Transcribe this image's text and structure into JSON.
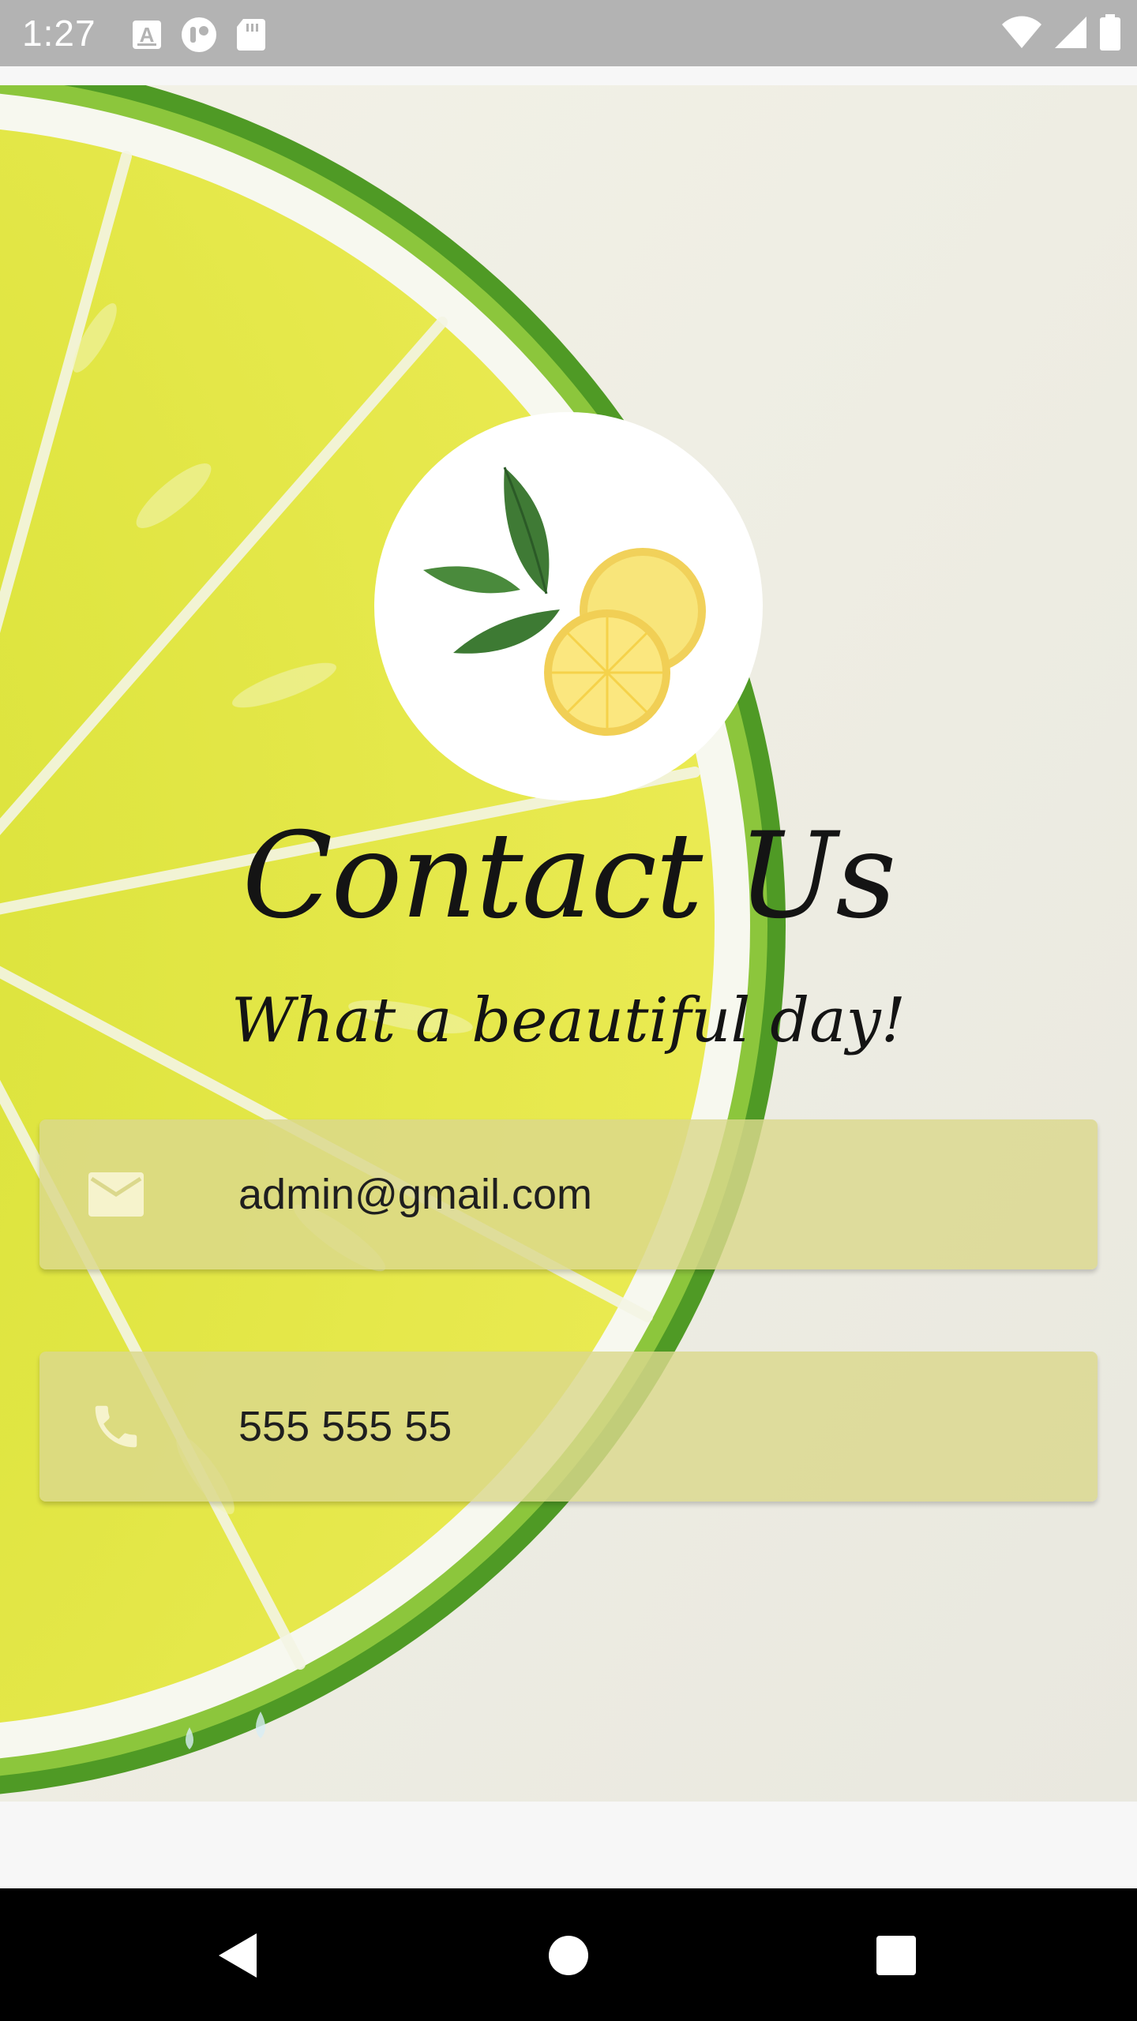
{
  "status_bar": {
    "time": "1:27",
    "left_icons": [
      "a-font-icon",
      "account-circle-icon",
      "sd-card-icon"
    ],
    "right_icons": [
      "wifi-icon",
      "signal-icon",
      "battery-icon"
    ]
  },
  "header": {
    "title": "Contact Us",
    "subtitle": "What a beautiful day!"
  },
  "contact": {
    "email_icon": "mail-icon",
    "email": "admin@gmail.com",
    "phone_icon": "phone-icon",
    "phone": "555 555 55"
  },
  "colors": {
    "field_background": "#dbd88c",
    "status_bar": "#b3b3b3",
    "lime_green": "#5aa12a",
    "lime_flesh": "#dfe34b"
  },
  "navigation": {
    "buttons": [
      "back-icon",
      "home-icon",
      "recents-icon"
    ]
  }
}
